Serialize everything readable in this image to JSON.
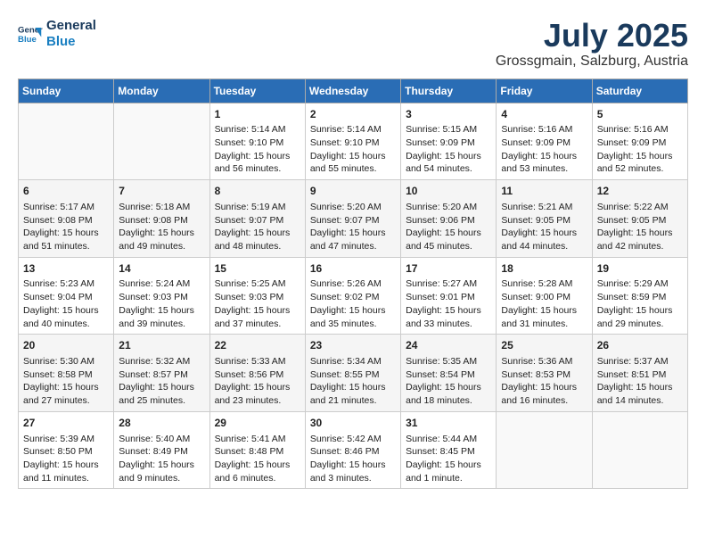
{
  "header": {
    "logo_line1": "General",
    "logo_line2": "Blue",
    "month": "July 2025",
    "location": "Grossgmain, Salzburg, Austria"
  },
  "weekdays": [
    "Sunday",
    "Monday",
    "Tuesday",
    "Wednesday",
    "Thursday",
    "Friday",
    "Saturday"
  ],
  "weeks": [
    [
      {
        "day": "",
        "info": ""
      },
      {
        "day": "",
        "info": ""
      },
      {
        "day": "1",
        "info": "Sunrise: 5:14 AM\nSunset: 9:10 PM\nDaylight: 15 hours\nand 56 minutes."
      },
      {
        "day": "2",
        "info": "Sunrise: 5:14 AM\nSunset: 9:10 PM\nDaylight: 15 hours\nand 55 minutes."
      },
      {
        "day": "3",
        "info": "Sunrise: 5:15 AM\nSunset: 9:09 PM\nDaylight: 15 hours\nand 54 minutes."
      },
      {
        "day": "4",
        "info": "Sunrise: 5:16 AM\nSunset: 9:09 PM\nDaylight: 15 hours\nand 53 minutes."
      },
      {
        "day": "5",
        "info": "Sunrise: 5:16 AM\nSunset: 9:09 PM\nDaylight: 15 hours\nand 52 minutes."
      }
    ],
    [
      {
        "day": "6",
        "info": "Sunrise: 5:17 AM\nSunset: 9:08 PM\nDaylight: 15 hours\nand 51 minutes."
      },
      {
        "day": "7",
        "info": "Sunrise: 5:18 AM\nSunset: 9:08 PM\nDaylight: 15 hours\nand 49 minutes."
      },
      {
        "day": "8",
        "info": "Sunrise: 5:19 AM\nSunset: 9:07 PM\nDaylight: 15 hours\nand 48 minutes."
      },
      {
        "day": "9",
        "info": "Sunrise: 5:20 AM\nSunset: 9:07 PM\nDaylight: 15 hours\nand 47 minutes."
      },
      {
        "day": "10",
        "info": "Sunrise: 5:20 AM\nSunset: 9:06 PM\nDaylight: 15 hours\nand 45 minutes."
      },
      {
        "day": "11",
        "info": "Sunrise: 5:21 AM\nSunset: 9:05 PM\nDaylight: 15 hours\nand 44 minutes."
      },
      {
        "day": "12",
        "info": "Sunrise: 5:22 AM\nSunset: 9:05 PM\nDaylight: 15 hours\nand 42 minutes."
      }
    ],
    [
      {
        "day": "13",
        "info": "Sunrise: 5:23 AM\nSunset: 9:04 PM\nDaylight: 15 hours\nand 40 minutes."
      },
      {
        "day": "14",
        "info": "Sunrise: 5:24 AM\nSunset: 9:03 PM\nDaylight: 15 hours\nand 39 minutes."
      },
      {
        "day": "15",
        "info": "Sunrise: 5:25 AM\nSunset: 9:03 PM\nDaylight: 15 hours\nand 37 minutes."
      },
      {
        "day": "16",
        "info": "Sunrise: 5:26 AM\nSunset: 9:02 PM\nDaylight: 15 hours\nand 35 minutes."
      },
      {
        "day": "17",
        "info": "Sunrise: 5:27 AM\nSunset: 9:01 PM\nDaylight: 15 hours\nand 33 minutes."
      },
      {
        "day": "18",
        "info": "Sunrise: 5:28 AM\nSunset: 9:00 PM\nDaylight: 15 hours\nand 31 minutes."
      },
      {
        "day": "19",
        "info": "Sunrise: 5:29 AM\nSunset: 8:59 PM\nDaylight: 15 hours\nand 29 minutes."
      }
    ],
    [
      {
        "day": "20",
        "info": "Sunrise: 5:30 AM\nSunset: 8:58 PM\nDaylight: 15 hours\nand 27 minutes."
      },
      {
        "day": "21",
        "info": "Sunrise: 5:32 AM\nSunset: 8:57 PM\nDaylight: 15 hours\nand 25 minutes."
      },
      {
        "day": "22",
        "info": "Sunrise: 5:33 AM\nSunset: 8:56 PM\nDaylight: 15 hours\nand 23 minutes."
      },
      {
        "day": "23",
        "info": "Sunrise: 5:34 AM\nSunset: 8:55 PM\nDaylight: 15 hours\nand 21 minutes."
      },
      {
        "day": "24",
        "info": "Sunrise: 5:35 AM\nSunset: 8:54 PM\nDaylight: 15 hours\nand 18 minutes."
      },
      {
        "day": "25",
        "info": "Sunrise: 5:36 AM\nSunset: 8:53 PM\nDaylight: 15 hours\nand 16 minutes."
      },
      {
        "day": "26",
        "info": "Sunrise: 5:37 AM\nSunset: 8:51 PM\nDaylight: 15 hours\nand 14 minutes."
      }
    ],
    [
      {
        "day": "27",
        "info": "Sunrise: 5:39 AM\nSunset: 8:50 PM\nDaylight: 15 hours\nand 11 minutes."
      },
      {
        "day": "28",
        "info": "Sunrise: 5:40 AM\nSunset: 8:49 PM\nDaylight: 15 hours\nand 9 minutes."
      },
      {
        "day": "29",
        "info": "Sunrise: 5:41 AM\nSunset: 8:48 PM\nDaylight: 15 hours\nand 6 minutes."
      },
      {
        "day": "30",
        "info": "Sunrise: 5:42 AM\nSunset: 8:46 PM\nDaylight: 15 hours\nand 3 minutes."
      },
      {
        "day": "31",
        "info": "Sunrise: 5:44 AM\nSunset: 8:45 PM\nDaylight: 15 hours\nand 1 minute."
      },
      {
        "day": "",
        "info": ""
      },
      {
        "day": "",
        "info": ""
      }
    ]
  ]
}
